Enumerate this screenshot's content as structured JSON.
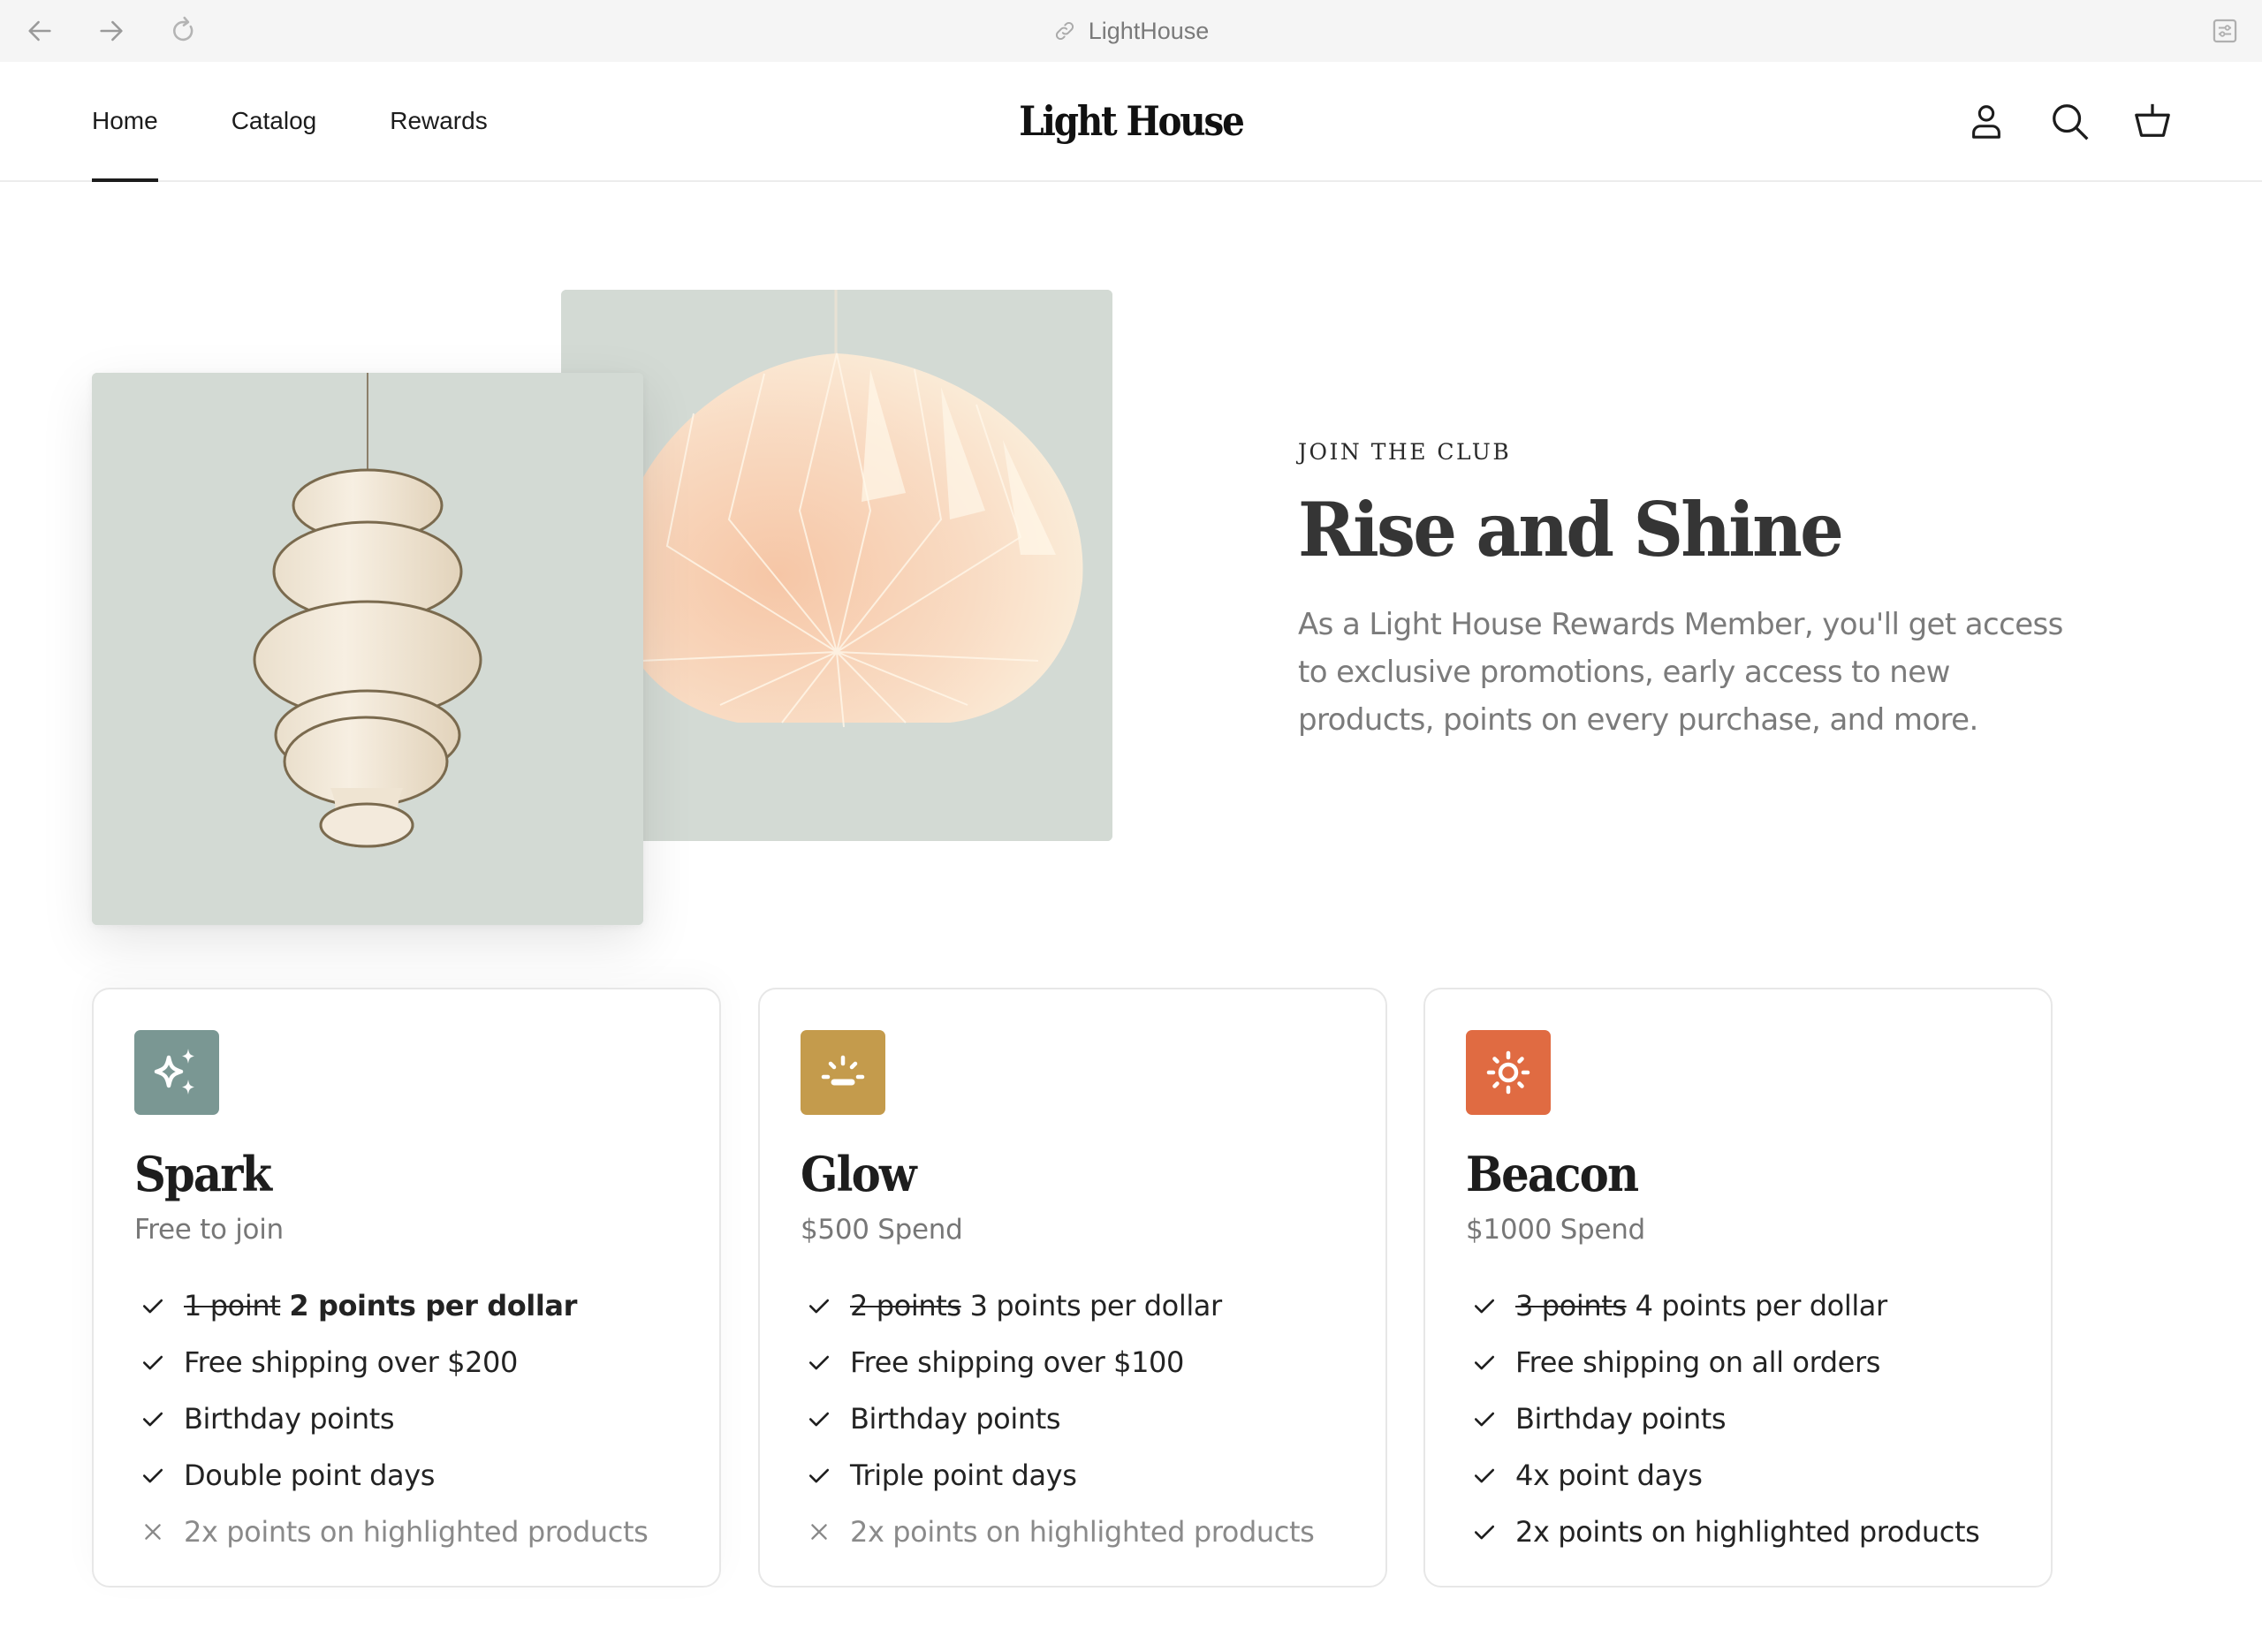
{
  "browser": {
    "url_title": "LightHouse",
    "icons": {
      "back": "arrow-left-icon",
      "forward": "arrow-right-icon",
      "reload": "reload-icon",
      "link": "link-icon",
      "settings": "sliders-icon"
    }
  },
  "header": {
    "logo": "Light House",
    "nav": [
      {
        "label": "Home",
        "active": true
      },
      {
        "label": "Catalog",
        "active": false
      },
      {
        "label": "Rewards",
        "active": false
      }
    ],
    "icons": [
      "account-icon",
      "search-icon",
      "basket-icon"
    ]
  },
  "hero": {
    "eyebrow": "JOIN THE CLUB",
    "title": "Rise and Shine",
    "description": "As a Light House Rewards Member, you'll get access to exclusive promotions, early access to new products, points on every purchase, and more.",
    "images": [
      {
        "subject": "origami paper pendant lamp"
      },
      {
        "subject": "stacked ribbed pendant lamp"
      }
    ]
  },
  "tiers": [
    {
      "name": "Spark",
      "subtitle": "Free to join",
      "icon": "sparkles-icon",
      "color": "#7a9793",
      "features": [
        {
          "included": true,
          "old": "1 point",
          "text": "2 points per dollar",
          "bold": true
        },
        {
          "included": true,
          "old": "",
          "text": "Free shipping over $200",
          "bold": false
        },
        {
          "included": true,
          "old": "",
          "text": "Birthday points",
          "bold": false
        },
        {
          "included": true,
          "old": "",
          "text": "Double point days",
          "bold": false
        },
        {
          "included": false,
          "old": "",
          "text": "2x points on highlighted products",
          "bold": false
        }
      ]
    },
    {
      "name": "Glow",
      "subtitle": "$500 Spend",
      "icon": "sunrise-icon",
      "color": "#c49b4c",
      "features": [
        {
          "included": true,
          "old": "2 points",
          "text": "3 points per dollar",
          "bold": false
        },
        {
          "included": true,
          "old": "",
          "text": "Free shipping over $100",
          "bold": false
        },
        {
          "included": true,
          "old": "",
          "text": "Birthday points",
          "bold": false
        },
        {
          "included": true,
          "old": "",
          "text": "Triple point days",
          "bold": false
        },
        {
          "included": false,
          "old": "",
          "text": "2x points on highlighted products",
          "bold": false
        }
      ]
    },
    {
      "name": "Beacon",
      "subtitle": "$1000 Spend",
      "icon": "sun-icon",
      "color": "#e06b42",
      "features": [
        {
          "included": true,
          "old": "3 points",
          "text": "4 points per dollar",
          "bold": false
        },
        {
          "included": true,
          "old": "",
          "text": "Free shipping on all orders",
          "bold": false
        },
        {
          "included": true,
          "old": "",
          "text": "Birthday points",
          "bold": false
        },
        {
          "included": true,
          "old": "",
          "text": "4x point days",
          "bold": false
        },
        {
          "included": true,
          "old": "",
          "text": "2x points on highlighted products",
          "bold": false
        }
      ]
    }
  ]
}
